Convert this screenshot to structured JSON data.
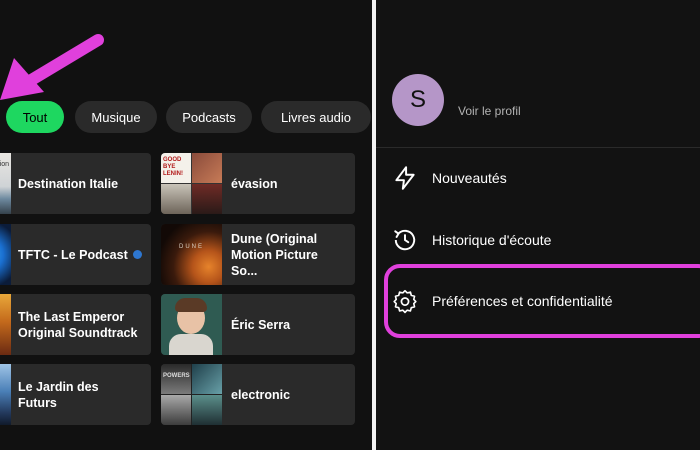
{
  "filters": {
    "all": "Tout",
    "music": "Musique",
    "podcasts": "Podcasts",
    "audiobooks": "Livres audio"
  },
  "tiles": [
    {
      "label": "Destination Italie",
      "art_text": "Destination\nItalie"
    },
    {
      "label": "évasion",
      "art_text": "GOOD BYE LENIN!"
    },
    {
      "label": "TFTC - Le Podcast"
    },
    {
      "label": "Dune (Original Motion Picture So...",
      "art_text": "DUNE"
    },
    {
      "label": "The Last Emperor Original Soundtrack"
    },
    {
      "label": "Éric Serra"
    },
    {
      "label": "Le Jardin des Futurs"
    },
    {
      "label": "electronic",
      "art_text": "POWERS"
    }
  ],
  "profile": {
    "initial": "S",
    "link": "Voir le profil"
  },
  "menu": {
    "news": "Nouveautés",
    "history": "Historique d'écoute",
    "settings": "Préférences et confidentialité"
  },
  "colors": {
    "accent_green": "#1ed760",
    "annotation_magenta": "#e040dc",
    "avatar": "#b596c8"
  }
}
